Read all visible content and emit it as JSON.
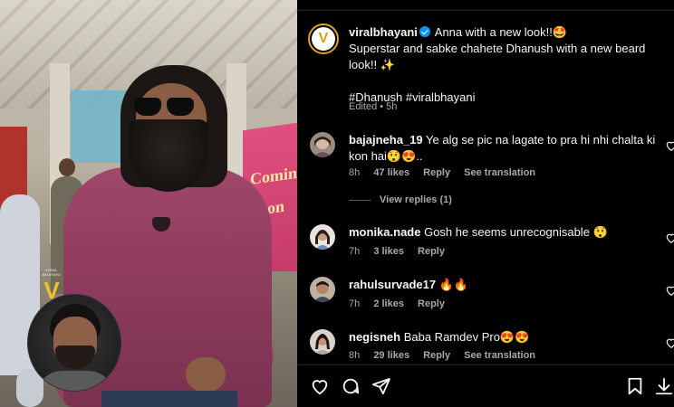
{
  "post": {
    "username": "viralbhayani",
    "caption_line1": "Anna with a new look!!🤩",
    "caption_line2": "Superstar and sabke chahete Dhanush with a new beard look!! ✨",
    "hashtags": "#Dhanush #viralbhayani",
    "meta": "Edited • 5h"
  },
  "photo": {
    "watermark_label": "VIRAL BHAYANI",
    "watermark_logo": "V",
    "banner_text_1": "Coming",
    "banner_text_2": "Soon"
  },
  "comments": [
    {
      "username": "bajajneha_19",
      "text": "Ye alg se pic na lagate to pra hi nhi chalta ki kon hai😲😍..",
      "time": "8h",
      "likes": "47 likes",
      "reply": "Reply",
      "translate": "See translation",
      "view_replies": "View replies (1)"
    },
    {
      "username": "monika.nade",
      "text": "Gosh he seems unrecognisable 😲",
      "time": "7h",
      "likes": "3 likes",
      "reply": "Reply"
    },
    {
      "username": "rahulsurvade17",
      "text": "🔥🔥",
      "time": "7h",
      "likes": "2 likes",
      "reply": "Reply"
    },
    {
      "username": "negisneh",
      "text": "Baba Ramdev Pro😍😍",
      "time": "8h",
      "likes": "29 likes",
      "reply": "Reply",
      "translate": "See translation"
    }
  ],
  "actions": {
    "like_icon": "heart-icon",
    "comment_icon": "comment-icon",
    "share_icon": "share-icon",
    "save_icon": "bookmark-icon",
    "download_icon": "download-icon"
  },
  "colors": {
    "background": "#000000",
    "text": "#f5f5f5",
    "muted": "#a8a8a8",
    "verified": "#0095f6",
    "hoodie": "#8b3a5c"
  }
}
